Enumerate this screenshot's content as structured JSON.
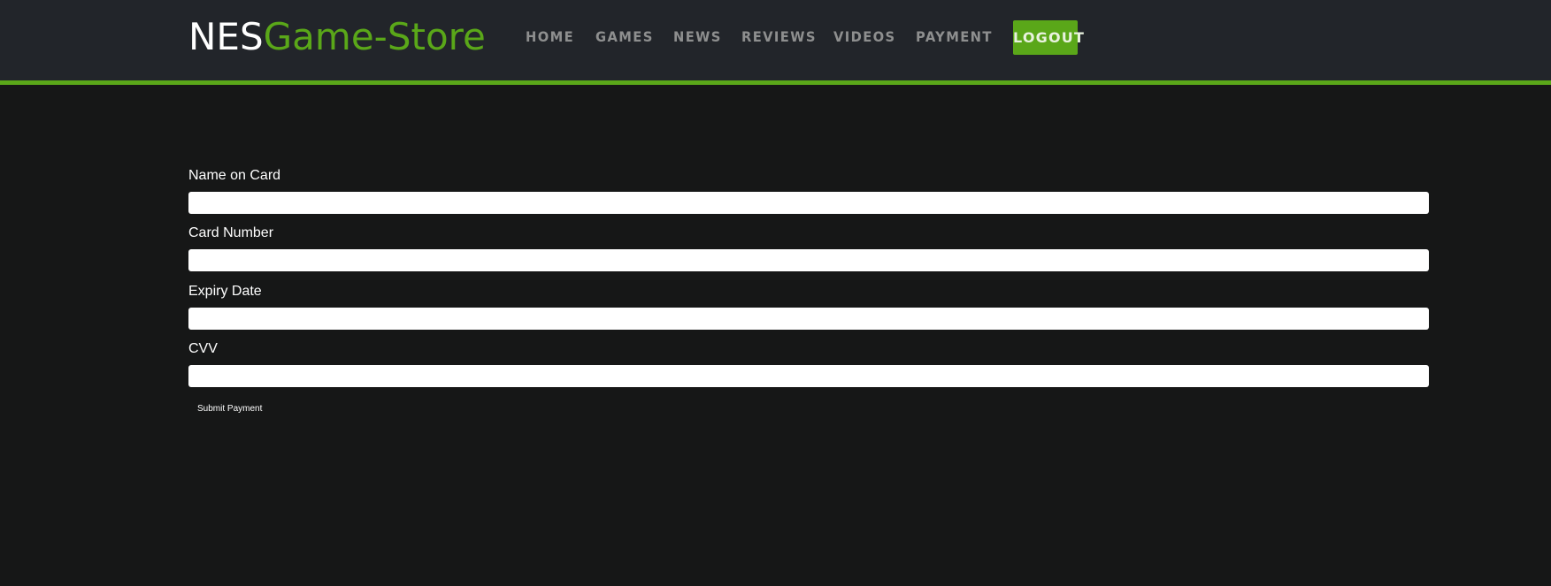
{
  "header": {
    "logo": {
      "part1": "NES",
      "part2": "Game-Store"
    },
    "nav": [
      {
        "label": "HOME"
      },
      {
        "label": "GAMES"
      },
      {
        "label": "NEWS"
      },
      {
        "label": "REVIEWS"
      },
      {
        "label": "VIDEOS"
      },
      {
        "label": "PAYMENT"
      }
    ],
    "logout_label": "LOGOUT"
  },
  "form": {
    "fields": [
      {
        "label": "Name on Card",
        "value": "",
        "placeholder": ""
      },
      {
        "label": "Card Number",
        "value": "",
        "placeholder": ""
      },
      {
        "label": "Expiry Date",
        "value": "",
        "placeholder": ""
      },
      {
        "label": "CVV",
        "value": "",
        "placeholder": ""
      }
    ],
    "submit_label": "Submit Payment"
  },
  "colors": {
    "accent": "#5aa719",
    "header_bg": "#22252a",
    "page_bg": "#161717",
    "nav_text": "#8e8f8f"
  }
}
